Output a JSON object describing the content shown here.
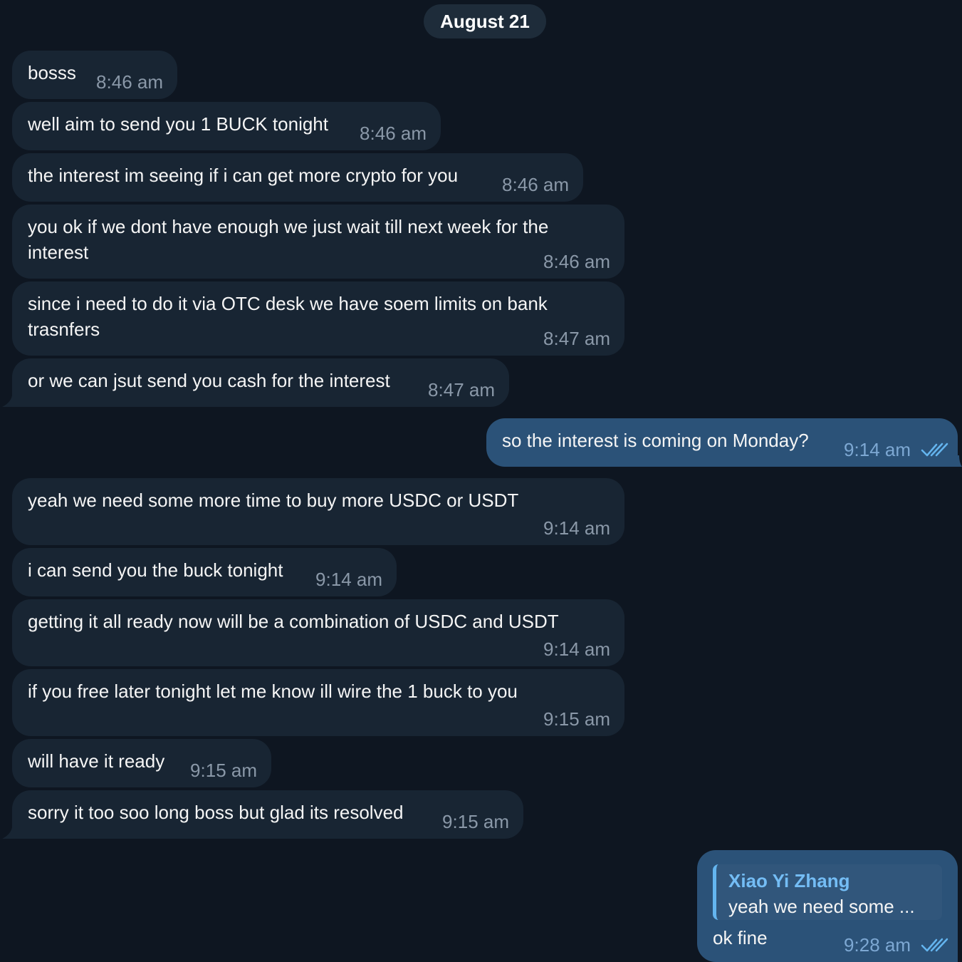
{
  "chat": {
    "date_separator": "August 21",
    "messages": [
      {
        "text": "bosss",
        "time": "8:46 am"
      },
      {
        "text": "well aim to send you 1 BUCK tonight",
        "time": "8:46 am"
      },
      {
        "text": "the interest im seeing if i can get more crypto for you",
        "time": "8:46 am"
      },
      {
        "text": "you ok if we dont have enough we just wait till next week for the interest",
        "time": "8:46 am"
      },
      {
        "text": "since i need to do it via OTC desk we have soem limits on bank trasnfers",
        "time": "8:47 am"
      },
      {
        "text": "or we can jsut send you cash for the interest",
        "time": "8:47 am"
      },
      {
        "text": "so the interest is coming on Monday?",
        "time": "9:14 am",
        "read_icon": "double-check-icon"
      },
      {
        "text": "yeah we need some more time to buy more USDC or USDT",
        "time": "9:14 am"
      },
      {
        "text": "i can send you the buck tonight",
        "time": "9:14 am"
      },
      {
        "text": "getting it all ready now will be a combination of USDC and USDT",
        "time": "9:14 am"
      },
      {
        "text": "if you free later tonight let me know ill wire the 1 buck to you",
        "time": "9:15 am"
      },
      {
        "text": "will have it ready",
        "time": "9:15 am"
      },
      {
        "text": "sorry it too soo long boss but glad its resolved",
        "time": "9:15 am"
      },
      {
        "text": "ok fine",
        "time": "9:28 am",
        "read_icon": "double-check-icon",
        "reply": {
          "name": "Xiao Yi Zhang",
          "text": "yeah we need some ..."
        }
      }
    ]
  },
  "colors": {
    "background": "#0e1621",
    "incoming_bubble": "#182533",
    "outgoing_bubble": "#2b5278",
    "accent": "#64b5ef"
  }
}
